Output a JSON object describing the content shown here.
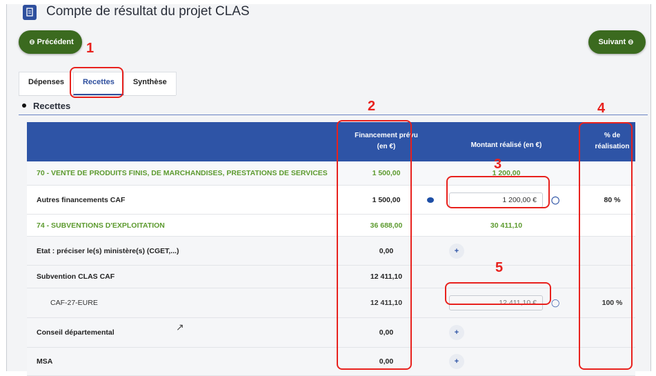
{
  "header": {
    "title": "Compte de résultat du projet CLAS",
    "doc_icon": "document-icon"
  },
  "nav": {
    "prev_label": "Précédent",
    "next_label": "Suivant",
    "prev_icon": "⊖",
    "next_icon": "⊖"
  },
  "tabs": [
    {
      "label": "Dépenses",
      "active": false
    },
    {
      "label": "Recettes",
      "active": true
    },
    {
      "label": "Synthèse",
      "active": false
    }
  ],
  "section": {
    "title": "Recettes"
  },
  "table": {
    "headers": {
      "financement_line1": "Financement prévu",
      "financement_line2": "(en €)",
      "montant": "Montant réalisé (en €)",
      "pct_line1": "% de",
      "pct_line2": "réalisation"
    },
    "rows": [
      {
        "label": "70 - VENTE DE PRODUITS FINIS, DE MARCHANDISES, PRESTATIONS DE SERVICES",
        "financement": "1 500,00",
        "montant": "1 200,00",
        "pct": ""
      },
      {
        "label": "Autres financements CAF",
        "financement": "1 500,00",
        "montant": "1 200,00 €",
        "pct": "80 %"
      },
      {
        "label": "74 - SUBVENTIONS D'EXPLOITATION",
        "financement": "36 688,00",
        "montant": "30 411,10",
        "pct": ""
      },
      {
        "label": "Etat : préciser le(s) ministère(s) (CGET,...)",
        "financement": "0,00",
        "montant": "",
        "pct": ""
      },
      {
        "label": "Subvention CLAS CAF",
        "financement": "12 411,10",
        "montant": "",
        "pct": ""
      },
      {
        "label": "CAF-27-EURE",
        "financement": "12 411,10",
        "montant": "12 411,10 €",
        "pct": "100 %"
      },
      {
        "label": "Conseil départemental",
        "financement": "0,00",
        "montant": "",
        "pct": ""
      },
      {
        "label": "MSA",
        "financement": "0,00",
        "montant": "",
        "pct": ""
      }
    ]
  },
  "annotations": [
    "1",
    "2",
    "3",
    "4",
    "5"
  ],
  "colors": {
    "accent_blue": "#2e54a6",
    "nav_green": "#3b6a1f",
    "category_green": "#5c9a2e",
    "annotation_red": "#e8211d"
  }
}
